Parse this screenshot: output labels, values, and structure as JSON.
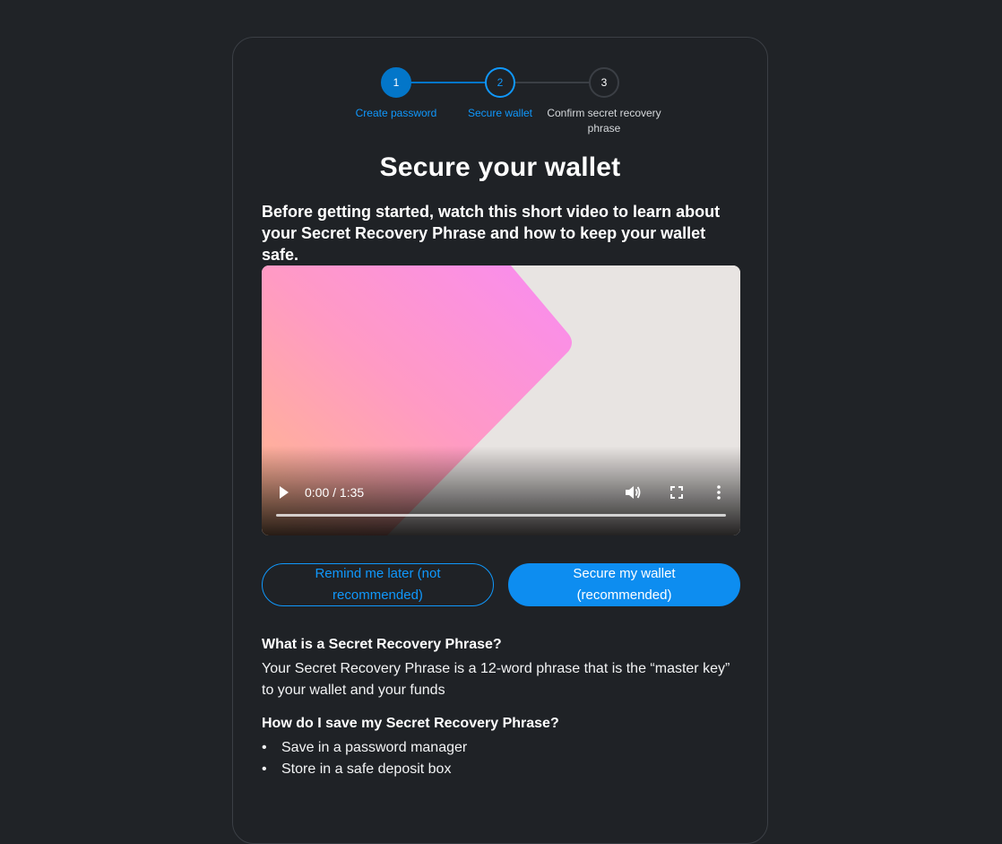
{
  "stepper": {
    "steps": [
      {
        "number": "1",
        "label": "Create password"
      },
      {
        "number": "2",
        "label": "Secure wallet"
      },
      {
        "number": "3",
        "label": "Confirm secret recovery phrase"
      }
    ]
  },
  "title": "Secure your wallet",
  "intro": "Before getting started, watch this short video to learn about your Secret Recovery Phrase and how to keep your wallet safe.",
  "video": {
    "time": "0:00 / 1:35",
    "progress": 0
  },
  "buttons": {
    "remind_later": "Remind me later (not recommended)",
    "secure_wallet": "Secure my wallet (recommended)"
  },
  "faq": {
    "q1": "What is a Secret Recovery Phrase?",
    "a1": "Your Secret Recovery Phrase is a 12-word phrase that is the “master key” to your wallet and your funds",
    "q2": "How do I save my Secret Recovery Phrase?",
    "tips": [
      "Save in a password manager",
      "Store in a safe deposit box"
    ]
  },
  "colors": {
    "accent": "#0376c9",
    "accent_text": "#1098fc",
    "background": "#202327"
  }
}
